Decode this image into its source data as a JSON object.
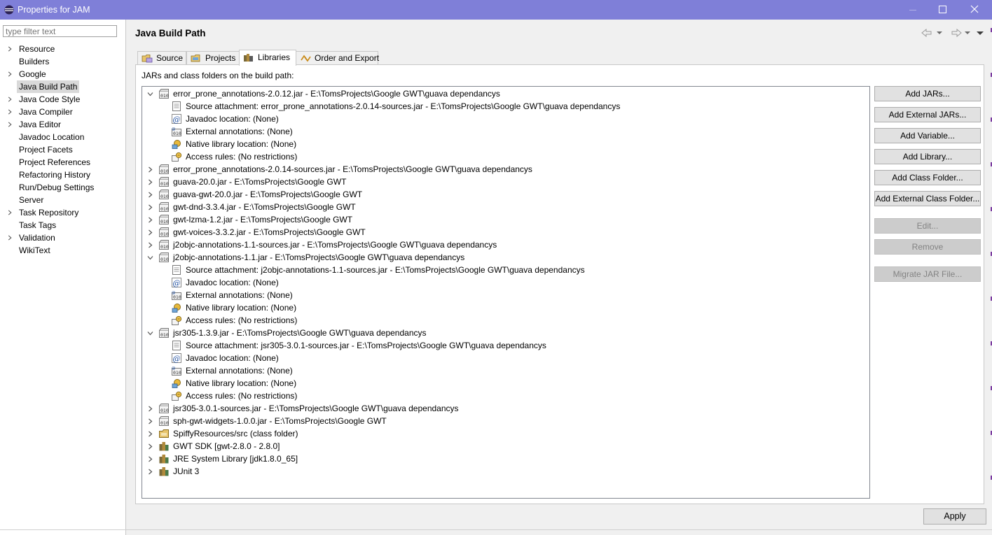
{
  "window": {
    "title": "Properties for JAM"
  },
  "colors": {
    "titlebar": "#7f7fd8",
    "selected_nav": "#d9d9d9",
    "disabled_button": "#cccccc"
  },
  "filter": {
    "placeholder": "type filter text"
  },
  "nav": {
    "items": [
      {
        "label": "Resource",
        "expandable": true
      },
      {
        "label": "Builders",
        "expandable": false
      },
      {
        "label": "Google",
        "expandable": true
      },
      {
        "label": "Java Build Path",
        "expandable": false,
        "selected": true
      },
      {
        "label": "Java Code Style",
        "expandable": true
      },
      {
        "label": "Java Compiler",
        "expandable": true
      },
      {
        "label": "Java Editor",
        "expandable": true
      },
      {
        "label": "Javadoc Location",
        "expandable": false
      },
      {
        "label": "Project Facets",
        "expandable": false
      },
      {
        "label": "Project References",
        "expandable": false
      },
      {
        "label": "Refactoring History",
        "expandable": false
      },
      {
        "label": "Run/Debug Settings",
        "expandable": false
      },
      {
        "label": "Server",
        "expandable": false
      },
      {
        "label": "Task Repository",
        "expandable": true
      },
      {
        "label": "Task Tags",
        "expandable": false
      },
      {
        "label": "Validation",
        "expandable": true
      },
      {
        "label": "WikiText",
        "expandable": false
      }
    ]
  },
  "page": {
    "title": "Java Build Path"
  },
  "tabs": [
    {
      "label": "Source",
      "icon": "source-folder-icon"
    },
    {
      "label": "Projects",
      "icon": "projects-icon"
    },
    {
      "label": "Libraries",
      "icon": "libraries-icon",
      "active": true
    },
    {
      "label": "Order and Export",
      "icon": "order-export-icon"
    }
  ],
  "libraries": {
    "label": "JARs and class folders on the build path:",
    "tree": [
      {
        "label": "error_prone_annotations-2.0.12.jar - E:\\TomsProjects\\Google GWT\\guava dependancys",
        "icon": "jar-icon",
        "level": 0,
        "state": "expanded"
      },
      {
        "label": "Source attachment: error_prone_annotations-2.0.14-sources.jar - E:\\TomsProjects\\Google GWT\\guava dependancys",
        "icon": "source-attachment-icon",
        "level": 1,
        "state": "leaf"
      },
      {
        "label": "Javadoc location: (None)",
        "icon": "javadoc-icon",
        "level": 1,
        "state": "leaf"
      },
      {
        "label": "External annotations: (None)",
        "icon": "external-annotations-icon",
        "level": 1,
        "state": "leaf"
      },
      {
        "label": "Native library location: (None)",
        "icon": "native-library-icon",
        "level": 1,
        "state": "leaf"
      },
      {
        "label": "Access rules: (No restrictions)",
        "icon": "access-rules-icon",
        "level": 1,
        "state": "leaf"
      },
      {
        "label": "error_prone_annotations-2.0.14-sources.jar - E:\\TomsProjects\\Google GWT\\guava dependancys",
        "icon": "jar-icon",
        "level": 0,
        "state": "collapsed"
      },
      {
        "label": "guava-20.0.jar - E:\\TomsProjects\\Google GWT",
        "icon": "jar-icon",
        "level": 0,
        "state": "collapsed"
      },
      {
        "label": "guava-gwt-20.0.jar - E:\\TomsProjects\\Google GWT",
        "icon": "jar-icon",
        "level": 0,
        "state": "collapsed"
      },
      {
        "label": "gwt-dnd-3.3.4.jar - E:\\TomsProjects\\Google GWT",
        "icon": "jar-icon",
        "level": 0,
        "state": "collapsed"
      },
      {
        "label": "gwt-lzma-1.2.jar - E:\\TomsProjects\\Google GWT",
        "icon": "jar-icon",
        "level": 0,
        "state": "collapsed"
      },
      {
        "label": "gwt-voices-3.3.2.jar - E:\\TomsProjects\\Google GWT",
        "icon": "jar-icon",
        "level": 0,
        "state": "collapsed"
      },
      {
        "label": "j2objc-annotations-1.1-sources.jar - E:\\TomsProjects\\Google GWT\\guava dependancys",
        "icon": "jar-icon",
        "level": 0,
        "state": "collapsed"
      },
      {
        "label": "j2objc-annotations-1.1.jar - E:\\TomsProjects\\Google GWT\\guava dependancys",
        "icon": "jar-icon",
        "level": 0,
        "state": "expanded"
      },
      {
        "label": "Source attachment: j2objc-annotations-1.1-sources.jar - E:\\TomsProjects\\Google GWT\\guava dependancys",
        "icon": "source-attachment-icon",
        "level": 1,
        "state": "leaf"
      },
      {
        "label": "Javadoc location: (None)",
        "icon": "javadoc-icon",
        "level": 1,
        "state": "leaf"
      },
      {
        "label": "External annotations: (None)",
        "icon": "external-annotations-icon",
        "level": 1,
        "state": "leaf"
      },
      {
        "label": "Native library location: (None)",
        "icon": "native-library-icon",
        "level": 1,
        "state": "leaf"
      },
      {
        "label": "Access rules: (No restrictions)",
        "icon": "access-rules-icon",
        "level": 1,
        "state": "leaf"
      },
      {
        "label": "jsr305-1.3.9.jar - E:\\TomsProjects\\Google GWT\\guava dependancys",
        "icon": "jar-icon",
        "level": 0,
        "state": "expanded"
      },
      {
        "label": "Source attachment: jsr305-3.0.1-sources.jar - E:\\TomsProjects\\Google GWT\\guava dependancys",
        "icon": "source-attachment-icon",
        "level": 1,
        "state": "leaf"
      },
      {
        "label": "Javadoc location: (None)",
        "icon": "javadoc-icon",
        "level": 1,
        "state": "leaf"
      },
      {
        "label": "External annotations: (None)",
        "icon": "external-annotations-icon",
        "level": 1,
        "state": "leaf"
      },
      {
        "label": "Native library location: (None)",
        "icon": "native-library-icon",
        "level": 1,
        "state": "leaf"
      },
      {
        "label": "Access rules: (No restrictions)",
        "icon": "access-rules-icon",
        "level": 1,
        "state": "leaf"
      },
      {
        "label": "jsr305-3.0.1-sources.jar - E:\\TomsProjects\\Google GWT\\guava dependancys",
        "icon": "jar-icon",
        "level": 0,
        "state": "collapsed"
      },
      {
        "label": "sph-gwt-widgets-1.0.0.jar - E:\\TomsProjects\\Google GWT",
        "icon": "jar-icon",
        "level": 0,
        "state": "collapsed"
      },
      {
        "label": "SpiffyResources/src (class folder)",
        "icon": "class-folder-icon",
        "level": 0,
        "state": "collapsed"
      },
      {
        "label": "GWT SDK [gwt-2.8.0 - 2.8.0]",
        "icon": "library-container-icon",
        "level": 0,
        "state": "collapsed"
      },
      {
        "label": "JRE System Library [jdk1.8.0_65]",
        "icon": "library-container-icon",
        "level": 0,
        "state": "collapsed"
      },
      {
        "label": "JUnit 3",
        "icon": "library-container-icon",
        "level": 0,
        "state": "collapsed"
      }
    ]
  },
  "buttons": [
    {
      "id": "add-jars-button",
      "label": "Add JARs...",
      "enabled": true,
      "group": 0
    },
    {
      "id": "add-external-jars-button",
      "label": "Add External JARs...",
      "enabled": true,
      "group": 0
    },
    {
      "id": "add-variable-button",
      "label": "Add Variable...",
      "enabled": true,
      "group": 0
    },
    {
      "id": "add-library-button",
      "label": "Add Library...",
      "enabled": true,
      "group": 0
    },
    {
      "id": "add-class-folder-button",
      "label": "Add Class Folder...",
      "enabled": true,
      "group": 0
    },
    {
      "id": "add-external-class-folder-button",
      "label": "Add External Class Folder...",
      "enabled": true,
      "group": 0
    },
    {
      "id": "edit-button",
      "label": "Edit...",
      "enabled": false,
      "group": 1
    },
    {
      "id": "remove-button",
      "label": "Remove",
      "enabled": false,
      "group": 1
    },
    {
      "id": "migrate-jar-file-button",
      "label": "Migrate JAR File...",
      "enabled": false,
      "group": 2
    }
  ],
  "footer": {
    "apply_label": "Apply"
  }
}
